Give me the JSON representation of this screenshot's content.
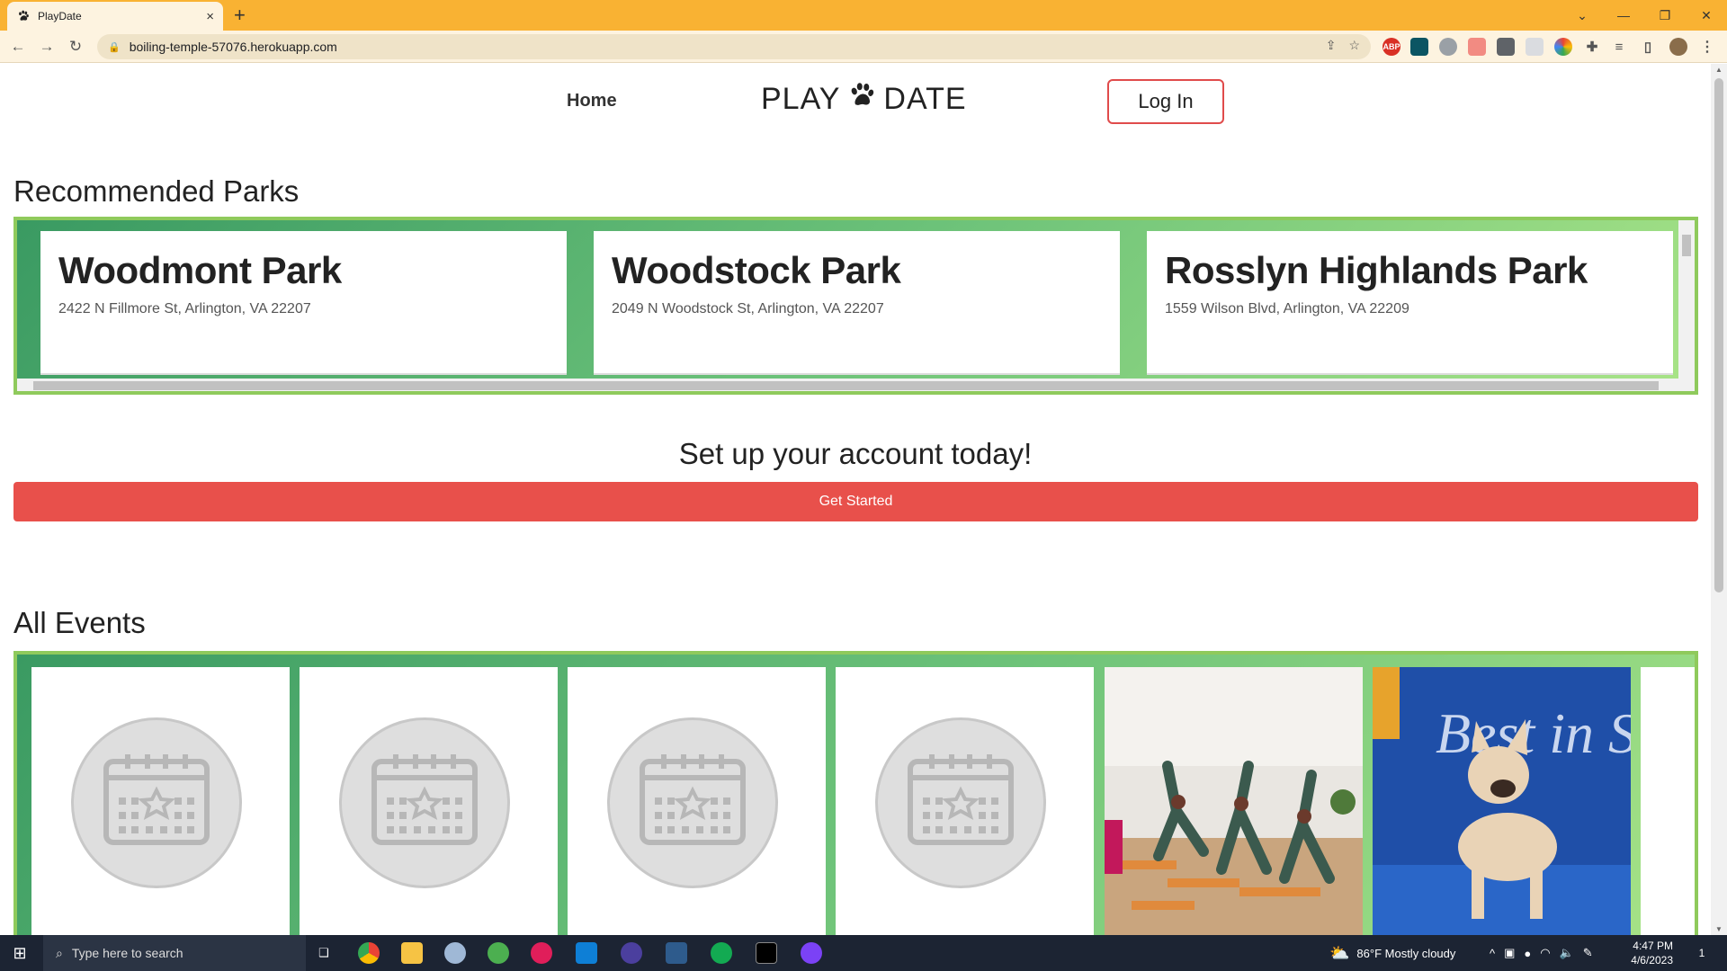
{
  "browser": {
    "tab_title": "PlayDate",
    "url": "boiling-temple-57076.herokuapp.com",
    "new_tab": "+",
    "close_tab": "×"
  },
  "nav": {
    "home": "Home",
    "brand_left": "PLAY",
    "brand_right": "DATE",
    "login": "Log In"
  },
  "parks": {
    "title": "Recommended Parks",
    "items": [
      {
        "name": "Woodmont Park",
        "address": "2422 N Fillmore St, Arlington, VA 22207"
      },
      {
        "name": "Woodstock Park",
        "address": "2049 N Woodstock St, Arlington, VA 22207"
      },
      {
        "name": "Rosslyn Highlands Park",
        "address": "1559 Wilson Blvd, Arlington, VA 22209"
      }
    ]
  },
  "cta": {
    "heading": "Set up your account today!",
    "button": "Get Started"
  },
  "events": {
    "title": "All Events",
    "photo_text": "Best in Show"
  },
  "taskbar": {
    "search_placeholder": "Type here to search",
    "weather": "86°F  Mostly cloudy",
    "time": "4:47 PM",
    "date": "4/6/2023",
    "notifications": "1"
  },
  "colors": {
    "tab_strip": "#f9b233",
    "accent_red": "#e8504b",
    "green_dark": "#3a9a62",
    "green_light": "#a9e487"
  }
}
